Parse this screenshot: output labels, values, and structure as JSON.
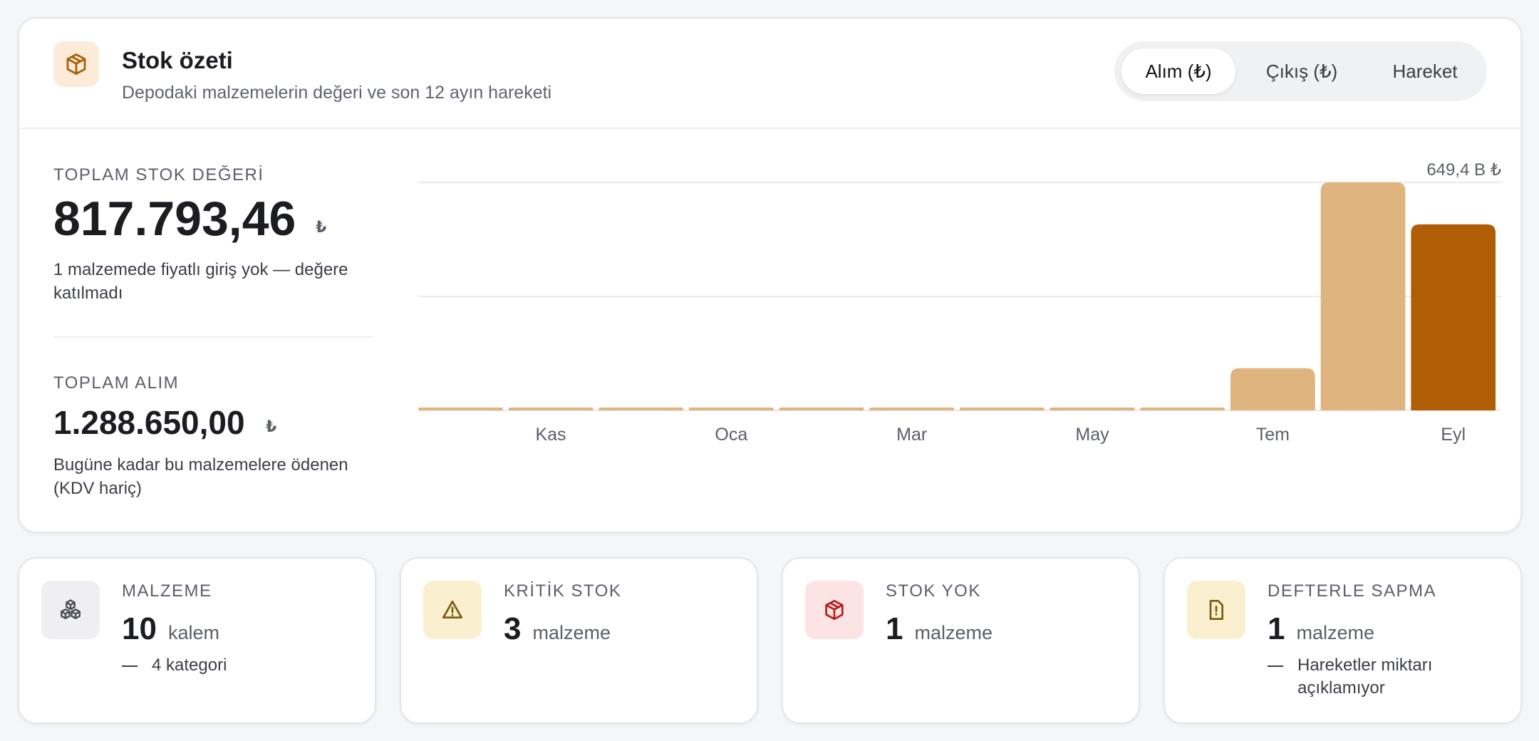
{
  "header": {
    "title": "Stok özeti",
    "subtitle": "Depodaki malzemelerin değeri ve son 12 ayın hareketi",
    "icon": "package-icon"
  },
  "toggle": {
    "options": [
      "Alım (₺)",
      "Çıkış (₺)",
      "Hareket"
    ],
    "selected": "Alım (₺)"
  },
  "stock_value": {
    "label": "TOPLAM STOK DEĞERİ",
    "value": "817.793,46",
    "currency": "₺",
    "note": "1 malzemede fiyatlı giriş yok — değere katılmadı"
  },
  "purchases": {
    "label": "TOPLAM ALIM",
    "value": "1.288.650,00",
    "currency": "₺",
    "note": "Bugüne kadar bu malzemelere ödenen (KDV hariç)"
  },
  "chart_data": {
    "type": "bar",
    "categories": [
      "",
      "Kas",
      "",
      "Oca",
      "",
      "Mar",
      "",
      "May",
      "",
      "Tem",
      "",
      "Eyl"
    ],
    "values": [
      0,
      0,
      0,
      0,
      0,
      0,
      0,
      0,
      0,
      120,
      649.4,
      530
    ],
    "max_label": "649,4 B ₺",
    "ylim": [
      0,
      649.4
    ],
    "grid": true,
    "colors": {
      "bar": "#e0b47e",
      "current": "#b05e06",
      "grid": "#e8e9ec",
      "tick": "#5b5f69"
    }
  },
  "stats": [
    {
      "label": "MALZEME",
      "value": "10",
      "unit": "kalem",
      "footer": "4 kategori",
      "icon": "cubes-icon",
      "icon_bg": "#efeff1",
      "icon_color": "#4a4d56"
    },
    {
      "label": "KRİTİK STOK",
      "value": "3",
      "unit": "malzeme",
      "footer": "",
      "icon": "warning-icon",
      "icon_bg": "#faf0cf",
      "icon_color": "#7a5a0e"
    },
    {
      "label": "STOK YOK",
      "value": "1",
      "unit": "malzeme",
      "footer": "",
      "icon": "package-icon",
      "icon_bg": "#fde4e4",
      "icon_color": "#b71c1c"
    },
    {
      "label": "DEFTERLE SAPMA",
      "value": "1",
      "unit": "malzeme",
      "footer": "Hareketler miktarı açıklamıyor",
      "icon": "file-alert-icon",
      "icon_bg": "#faf0cf",
      "icon_color": "#7a5a0e"
    }
  ]
}
